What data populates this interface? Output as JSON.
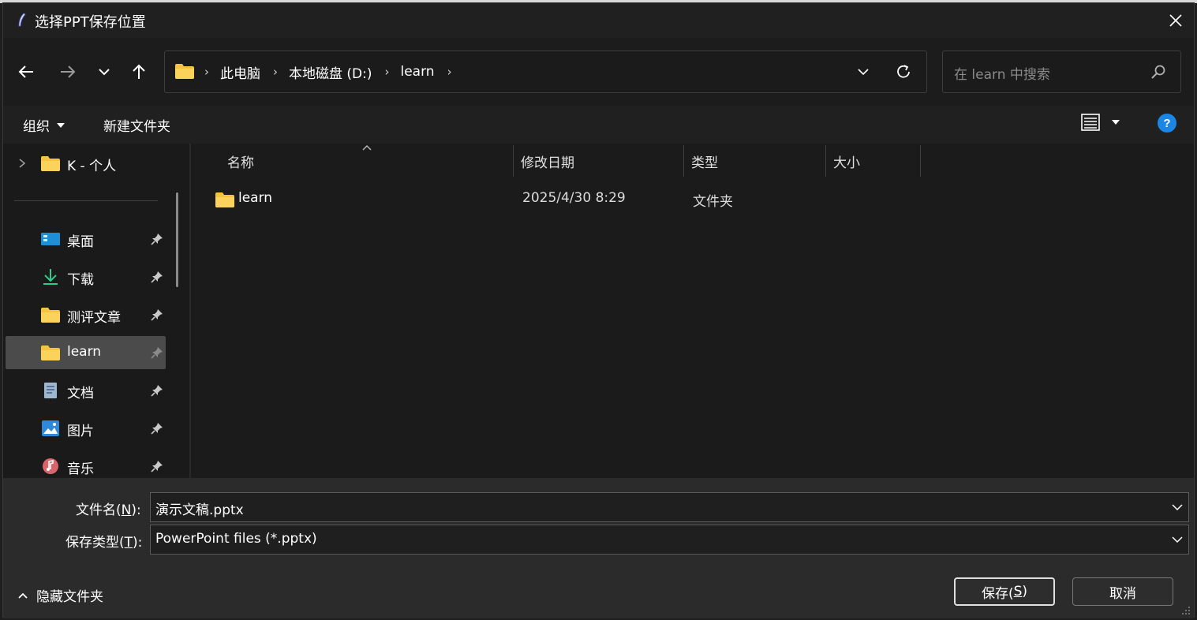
{
  "window": {
    "title": "选择PPT保存位置",
    "close_label": "✕"
  },
  "nav": {
    "back_icon": "back-arrow-icon",
    "forward_icon": "forward-arrow-icon",
    "recent_icon": "chevron-down-icon",
    "up_icon": "up-arrow-icon"
  },
  "address": {
    "crumbs": [
      "此电脑",
      "本地磁盘 (D:)",
      "learn"
    ]
  },
  "search": {
    "placeholder": "在 learn 中搜索"
  },
  "commands": {
    "organize": "组织",
    "new_folder": "新建文件夹",
    "help": "?"
  },
  "sidebar": {
    "top_item": "K - 个人",
    "quick_access": [
      {
        "label": "桌面",
        "icon": "desktop-icon"
      },
      {
        "label": "下载",
        "icon": "download-icon"
      },
      {
        "label": "测评文章",
        "icon": "folder-icon"
      },
      {
        "label": "learn",
        "icon": "folder-icon",
        "selected": true
      },
      {
        "label": "文档",
        "icon": "document-icon"
      },
      {
        "label": "图片",
        "icon": "pictures-icon"
      },
      {
        "label": "音乐",
        "icon": "music-icon"
      }
    ]
  },
  "filelist": {
    "columns": [
      "名称",
      "修改日期",
      "类型",
      "大小"
    ],
    "rows": [
      {
        "name": "learn",
        "modified": "2025/4/30 8:29",
        "type": "文件夹",
        "size": ""
      }
    ]
  },
  "form": {
    "filename_label": "文件名(",
    "filename_key": "N",
    "filename_label_end": "):",
    "filename_value": "演示文稿.pptx",
    "filetype_label": "保存类型(",
    "filetype_key": "T",
    "filetype_label_end": "):",
    "filetype_value": "PowerPoint files (*.pptx)"
  },
  "footer": {
    "hide_folders": "隐藏文件夹",
    "save_label": "保存(",
    "save_key": "S",
    "save_label_end": ")",
    "cancel_label": "取消"
  },
  "colors": {
    "accent": "#1a86e6",
    "folder": "#f5c242",
    "selected_bg": "#4b4b4b"
  }
}
